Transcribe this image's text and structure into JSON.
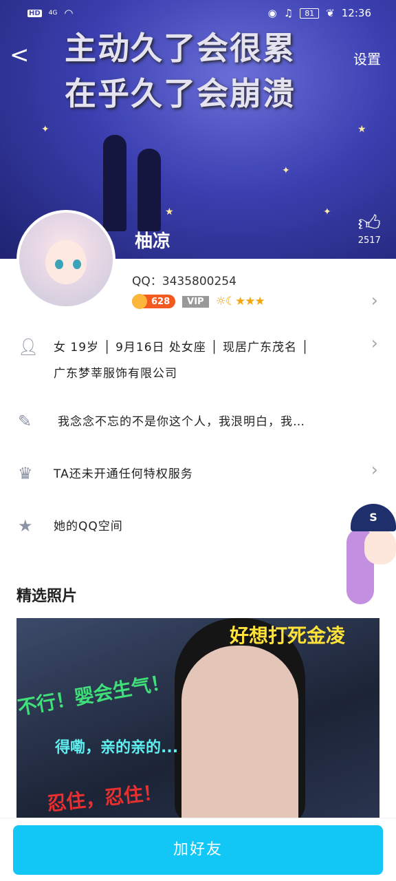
{
  "status_bar": {
    "left": [
      "HD",
      "4G",
      "wifi"
    ],
    "time": "12:36",
    "battery": "81"
  },
  "header": {
    "banner_lines": [
      "主动久了会很累",
      "在乎久了会崩溃"
    ],
    "settings_label": "设置",
    "nickname": "柚凉",
    "likes": "2517"
  },
  "profile": {
    "qq_label": "QQ：",
    "qq_number": "3435800254",
    "coin_value": "628",
    "vip_label": "VIP",
    "level_icons": "☼☾★★★"
  },
  "info_rows": [
    {
      "icon": "person-icon",
      "text": "女  19岁 │ 9月16日  处女座 │ 现居广东茂名 │",
      "text2": "广东梦莘服饰有限公司"
    },
    {
      "icon": "pencil-icon",
      "text": "我念念不忘的不是你这个人，我泿明白，我…"
    },
    {
      "icon": "crown-icon",
      "text": "TA还未开通任何特权服务"
    },
    {
      "icon": "qzone-star-icon",
      "text": "她的QQ空间"
    }
  ],
  "photos": {
    "title": "精选照片",
    "captions": [
      "好想打死金凌",
      "不行！婴会生气！",
      "得嘞，亲的亲的...",
      "忍住，忍住！"
    ]
  },
  "mascot": {
    "cap_letter": "S"
  },
  "bottom": {
    "add_friend_label": "加好友"
  },
  "colors": {
    "accent": "#12c6f5",
    "coin": "#f25a1f",
    "stars": "#f5a60c"
  }
}
